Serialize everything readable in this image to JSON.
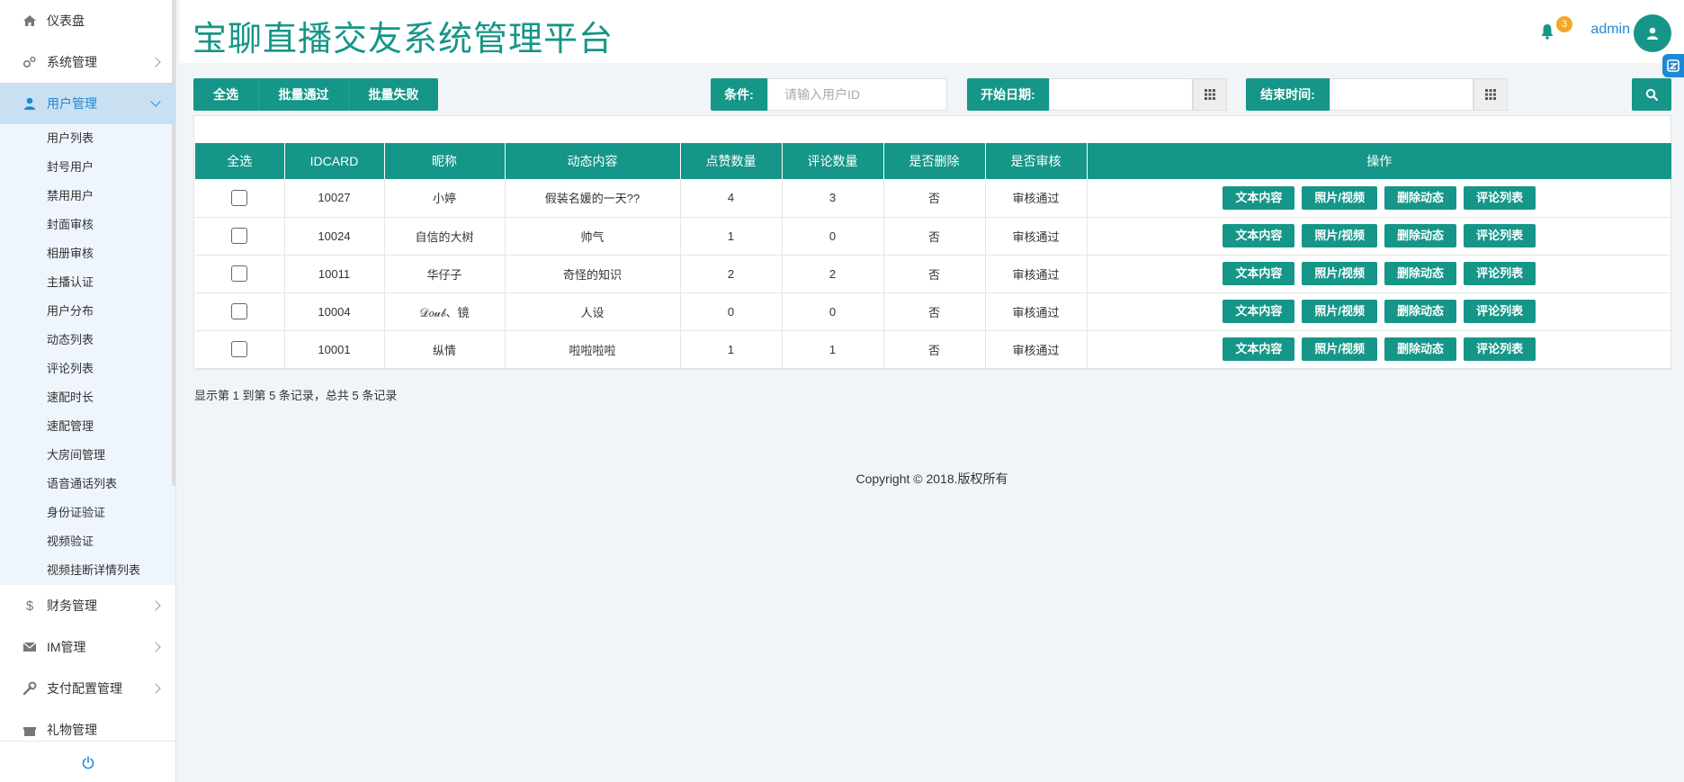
{
  "app": {
    "title": "宝聊直播交友系统管理平台",
    "notification_count": "3",
    "user": "admin",
    "accent": "#159688",
    "link_color": "#1e88d4"
  },
  "sidebar": {
    "items": [
      {
        "label": "仪表盘",
        "icon": "home-icon"
      },
      {
        "label": "系统管理",
        "icon": "settings-icon"
      },
      {
        "label": "用户管理",
        "icon": "user-icon"
      },
      {
        "label": "财务管理",
        "icon": "dollar-icon"
      },
      {
        "label": "IM管理",
        "icon": "mail-icon"
      },
      {
        "label": "支付配置管理",
        "icon": "wrench-icon"
      },
      {
        "label": "礼物管理",
        "icon": "gift-icon"
      }
    ],
    "submenu": [
      "用户列表",
      "封号用户",
      "禁用用户",
      "封面审核",
      "相册审核",
      "主播认证",
      "用户分布",
      "动态列表",
      "评论列表",
      "速配时长",
      "速配管理",
      "大房间管理",
      "语音通话列表",
      "身份证验证",
      "视频验证",
      "视频挂断详情列表"
    ]
  },
  "toolbar": {
    "select_all": "全选",
    "batch_pass": "批量通过",
    "batch_fail": "批量失败",
    "condition_label": "条件:",
    "condition_placeholder": "请输入用户ID",
    "start_label": "开始日期:",
    "end_label": "结束时间:"
  },
  "table": {
    "headers": [
      "全选",
      "IDCARD",
      "昵称",
      "动态内容",
      "点赞数量",
      "评论数量",
      "是否删除",
      "是否审核",
      "操作"
    ],
    "rows": [
      {
        "id": "10027",
        "nick": "小婷",
        "content": "假装名媛的一天??",
        "likes": "4",
        "comments": "3",
        "deleted": "否",
        "audit": "审核通过"
      },
      {
        "id": "10024",
        "nick": "自信的大树",
        "content": "帅气",
        "likes": "1",
        "comments": "0",
        "deleted": "否",
        "audit": "审核通过"
      },
      {
        "id": "10011",
        "nick": "华仔子",
        "content": "奇怪的知识",
        "likes": "2",
        "comments": "2",
        "deleted": "否",
        "audit": "审核通过"
      },
      {
        "id": "10004",
        "nick": "𝒟𝑜𝓊𝒷、镜",
        "content": "人设",
        "likes": "0",
        "comments": "0",
        "deleted": "否",
        "audit": "审核通过"
      },
      {
        "id": "10001",
        "nick": "纵情",
        "content": "啦啦啦啦",
        "likes": "1",
        "comments": "1",
        "deleted": "否",
        "audit": "审核通过"
      }
    ],
    "actions": [
      "文本内容",
      "照片/视频",
      "删除动态",
      "评论列表"
    ]
  },
  "footer": {
    "records": "显示第 1 到第 5 条记录，总共 5 条记录",
    "copyright": "Copyright © 2018.版权所有"
  }
}
